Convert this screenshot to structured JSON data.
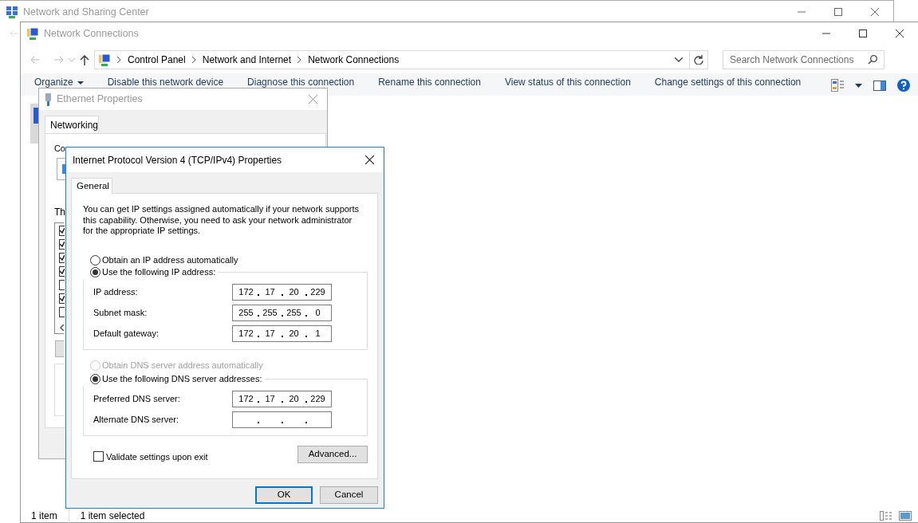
{
  "back_window": {
    "title": "Network and Sharing Center"
  },
  "window": {
    "title": "Network Connections",
    "breadcrumb": [
      "Control Panel",
      "Network and Internet",
      "Network Connections"
    ],
    "search": {
      "placeholder": "Search Network Connections"
    },
    "commands": [
      {
        "label": "Organize",
        "kind": "menu"
      },
      {
        "label": "Disable this network device",
        "kind": "action"
      },
      {
        "label": "Diagnose this connection",
        "kind": "action"
      },
      {
        "label": "Rename this connection",
        "kind": "action"
      },
      {
        "label": "View status of this connection",
        "kind": "action"
      },
      {
        "label": "Change settings of this connection",
        "kind": "action"
      }
    ],
    "status_bar": [
      "1 item",
      "1 item selected"
    ]
  },
  "ethernet_dialog": {
    "title": "Ethernet Properties",
    "tabs": [
      {
        "label": "Networking",
        "selected": true
      }
    ],
    "label_1": "Co",
    "label_2": "Th",
    "components": [
      {
        "checked": true
      },
      {
        "checked": true
      },
      {
        "checked": true
      },
      {
        "checked": true
      },
      {
        "checked": false
      },
      {
        "checked": true
      },
      {
        "checked": false
      }
    ]
  },
  "ipv4_dialog": {
    "title": "Internet Protocol Version 4 (TCP/IPv4) Properties",
    "tabs": [
      {
        "label": "General",
        "selected": true
      }
    ],
    "intro": "You can get IP settings assigned automatically if your network supports this capability. Otherwise, you need to ask your network administrator for the appropriate IP settings.",
    "ip_section": {
      "options": [
        {
          "label": "Obtain an IP address automatically",
          "selected": false,
          "disabled": false
        },
        {
          "label": "Use the following IP address:",
          "selected": true,
          "disabled": false
        }
      ],
      "fields": [
        {
          "label": "IP address:",
          "octets": [
            "172",
            "17",
            "20",
            "229"
          ]
        },
        {
          "label": "Subnet mask:",
          "octets": [
            "255",
            "255",
            "255",
            "0"
          ]
        },
        {
          "label": "Default gateway:",
          "octets": [
            "172",
            "17",
            "20",
            "1"
          ]
        }
      ]
    },
    "dns_section": {
      "options": [
        {
          "label": "Obtain DNS server address automatically",
          "selected": false,
          "disabled": true
        },
        {
          "label": "Use the following DNS server addresses:",
          "selected": true,
          "disabled": false
        }
      ],
      "fields": [
        {
          "label": "Preferred DNS server:",
          "octets": [
            "172",
            "17",
            "20",
            "229"
          ]
        },
        {
          "label": "Alternate DNS server:"
        }
      ]
    },
    "validate": {
      "label": "Validate settings upon exit",
      "checked": false
    },
    "advanced_button": "Advanced...",
    "buttons": [
      {
        "label": "OK",
        "kind": "default"
      },
      {
        "label": "Cancel",
        "kind": "normal"
      }
    ]
  }
}
